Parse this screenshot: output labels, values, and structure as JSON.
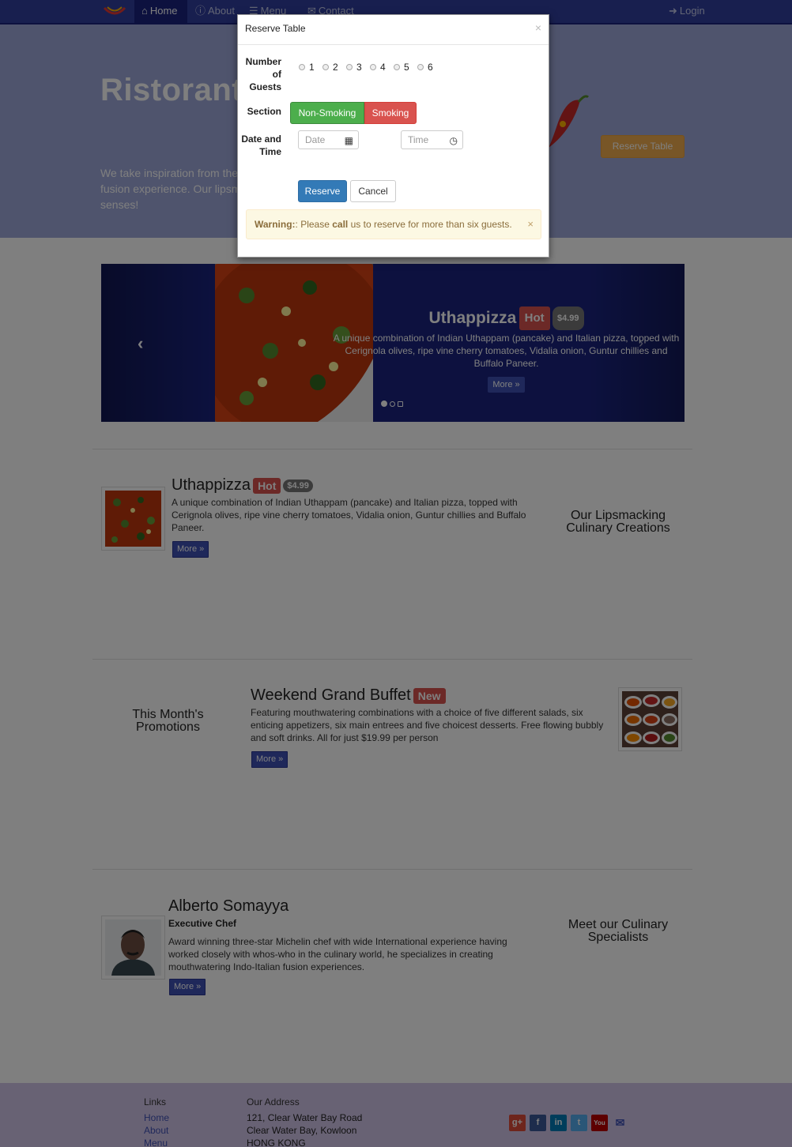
{
  "nav": {
    "brand_icon": "restaurant-logo",
    "home": "Home",
    "about": "About",
    "menu": "Menu",
    "contact": "Contact",
    "login": "Login"
  },
  "jumbotron": {
    "title": "Ristorante con Fusion",
    "text": "We take inspiration from the World's best cuisines, and create a unique fusion experience. Our lipsmacking creations will tickle your culinary senses!",
    "reserve_button": "Reserve Table"
  },
  "carousel": {
    "title": "Uthappizza",
    "label": "Hot",
    "price": "$4.99",
    "description": "A unique combination of Indian Uthappam (pancake) and Italian pizza, topped with Cerignola olives, ripe vine cherry tomatoes, Vidalia onion, Guntur chillies and Buffalo Paneer.",
    "more": "More »"
  },
  "dish": {
    "title": "Uthappizza",
    "label": "Hot",
    "price": "$4.99",
    "description": "A unique combination of Indian Uthappam (pancake) and Italian pizza, topped with Cerignola olives, ripe vine cherry tomatoes, Vidalia onion, Guntur chillies and Buffalo Paneer.",
    "more": "More »",
    "side_heading": "Our Lipsmacking Culinary Creations"
  },
  "promotion": {
    "title": "Weekend Grand Buffet",
    "label": "New",
    "description": "Featuring mouthwatering combinations with a choice of five different salads, six enticing appetizers, six main entrees and five choicest desserts. Free flowing bubbly and soft drinks. All for just $19.99 per person",
    "more": "More »",
    "side_heading": "This Month's Promotions"
  },
  "leader": {
    "name": "Alberto Somayya",
    "role": "Executive Chef",
    "description": "Award winning three-star Michelin chef with wide International experience having worked closely with whos-who in the culinary world, he specializes in creating mouthwatering Indo-Italian fusion experiences.",
    "more": "More »",
    "side_heading": "Meet our Culinary Specialists"
  },
  "footer": {
    "links_heading": "Links",
    "links": [
      "Home",
      "About",
      "Menu"
    ],
    "address_heading": "Our Address",
    "address": [
      "121, Clear Water Bay Road",
      "Clear Water Bay, Kowloon",
      "HONG KONG"
    ],
    "social": [
      {
        "icon": "google-plus-icon",
        "glyph": "g+",
        "color": "#dd4b39"
      },
      {
        "icon": "facebook-icon",
        "glyph": "f",
        "color": "#3b5998"
      },
      {
        "icon": "linkedin-icon",
        "glyph": "in",
        "color": "#007bb6"
      },
      {
        "icon": "twitter-icon",
        "glyph": "t",
        "color": "#55acee"
      },
      {
        "icon": "youtube-icon",
        "glyph": "You",
        "color": "#bb0000"
      }
    ]
  },
  "modal": {
    "title": "Reserve Table",
    "guests_label": "Number of Guests",
    "guest_options": [
      "1",
      "2",
      "3",
      "4",
      "5",
      "6"
    ],
    "section_label": "Section",
    "non_smoking": "Non-Smoking",
    "smoking": "Smoking",
    "datetime_label": "Date and Time",
    "date_placeholder": "Date",
    "time_placeholder": "Time",
    "reserve": "Reserve",
    "cancel": "Cancel",
    "warning_strong": "Warning:",
    "warning_pre": ": Please ",
    "warning_call": "call",
    "warning_post": " us to reserve for more than six guests."
  }
}
